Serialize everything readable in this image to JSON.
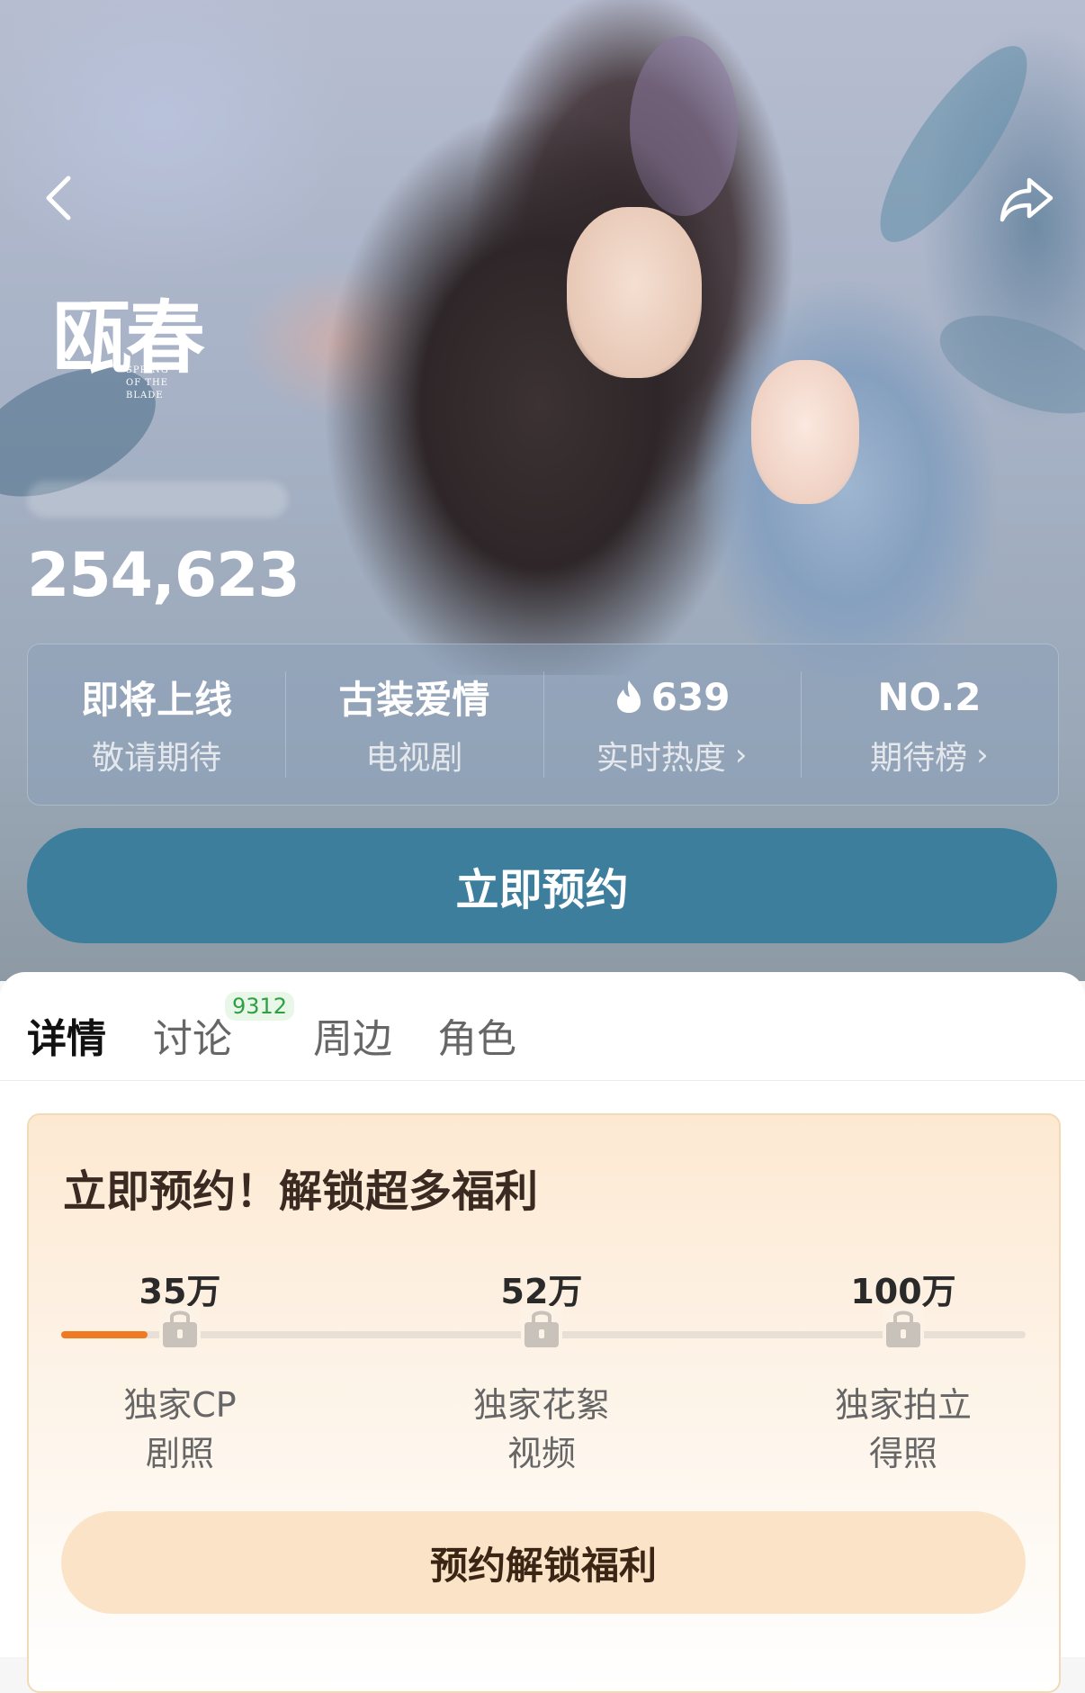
{
  "hero": {
    "logo_title": "瓯春",
    "logo_subtitle_line1": "SPRING",
    "logo_subtitle_line2": "OF THE BLADE",
    "count": "254,623"
  },
  "stats": [
    {
      "top": "即将上线",
      "bottom": "敬请期待"
    },
    {
      "top": "古装爱情",
      "bottom": "电视剧"
    },
    {
      "top": "639",
      "bottom": "实时热度",
      "icon": "flame-icon"
    },
    {
      "top": "NO.2",
      "bottom": "期待榜"
    }
  ],
  "reserve_button": "立即预约",
  "tabs": [
    {
      "label": "详情",
      "active": true
    },
    {
      "label": "讨论",
      "badge": "9312"
    },
    {
      "label": "周边"
    },
    {
      "label": "角色"
    }
  ],
  "promo": {
    "title": "立即预约！解锁超多福利",
    "progress_fraction": 0.09,
    "milestones": [
      {
        "value": "35万",
        "perk_line1": "独家CP",
        "perk_line2": "剧照"
      },
      {
        "value": "52万",
        "perk_line1": "独家花絮",
        "perk_line2": "视频"
      },
      {
        "value": "100万",
        "perk_line1": "独家拍立",
        "perk_line2": "得照"
      }
    ],
    "button": "预约解锁福利"
  },
  "colors": {
    "accent_button": "#3d7e9d",
    "progress": "#f07a22",
    "badge_text": "#2ea043"
  }
}
